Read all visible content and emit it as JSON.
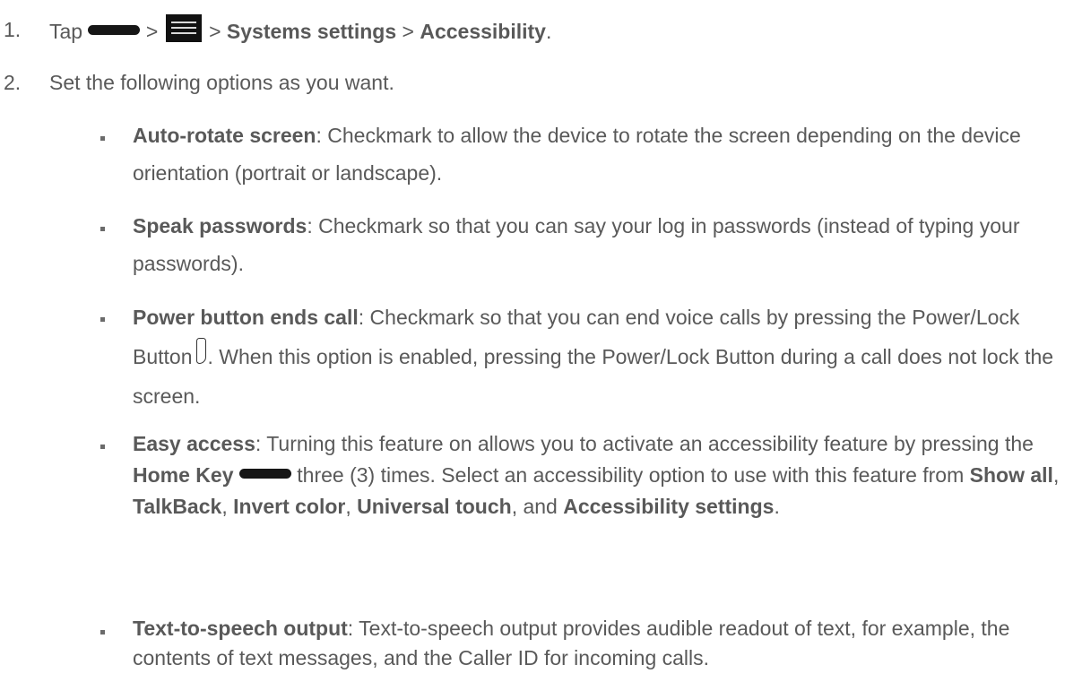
{
  "step1": {
    "number": "1.",
    "tap": "Tap",
    "sep1": ">",
    "sep2": ">",
    "system_settings": "Systems settings",
    "sep3": ">",
    "accessibility": "Accessibility",
    "end": "."
  },
  "step2": {
    "number": "2.",
    "text": "Set the following options as you want."
  },
  "options": {
    "auto_rotate": {
      "title": "Auto-rotate screen",
      "desc": ": Checkmark to allow the device to rotate the screen depending on the device orientation (portrait or landscape)."
    },
    "speak_passwords": {
      "title": "Speak passwords",
      "desc": ": Checkmark so that you can say your log in passwords (instead of typing your passwords)."
    },
    "power_button": {
      "title": "Power button ends call",
      "desc_a": ": Checkmark so that you can end voice calls by pressing the Power/Lock Button",
      "desc_b": ". When this option is enabled, pressing the Power/Lock Button during a call does not lock the screen."
    },
    "easy_access": {
      "title": "Easy access",
      "desc_a": ": Turning this feature on allows you to activate an accessibility feature by pressing the ",
      "home_key": "Home Key",
      "desc_b": " three (3) times. Select an accessibility option to use with this feature from ",
      "show_all": "Show all",
      "comma1": ", ",
      "talkback": "TalkBack",
      "comma2": ", ",
      "invert_color": "Invert color",
      "comma3": ", ",
      "universal_touch": "Universal touch",
      "and": ", and ",
      "accessibility_settings": "Accessibility settings",
      "end": "."
    },
    "tts": {
      "title": "Text-to-speech output",
      "desc": ": Text-to-speech output provides audible readout of text, for example, the contents of text messages, and the Caller ID for incoming calls."
    }
  }
}
